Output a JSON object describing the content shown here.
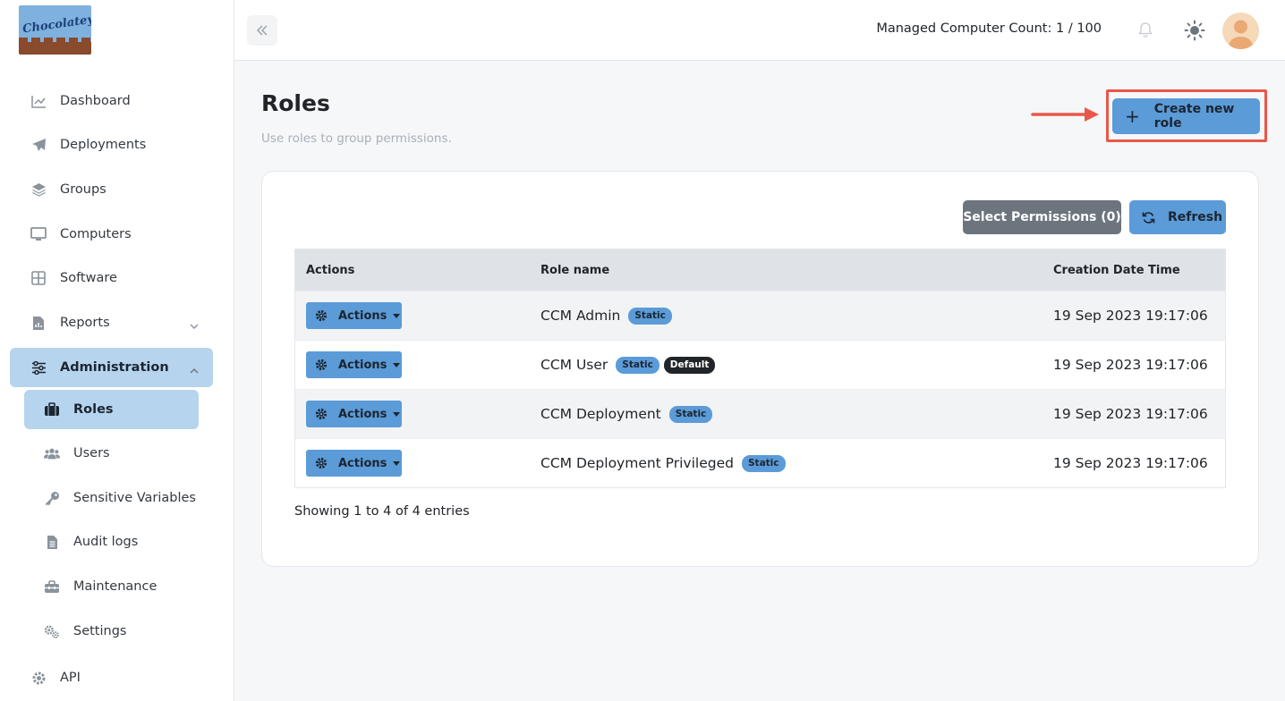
{
  "sidebar": {
    "logo_text": "Chocolatey",
    "items": [
      {
        "label": "Dashboard"
      },
      {
        "label": "Deployments"
      },
      {
        "label": "Groups"
      },
      {
        "label": "Computers"
      },
      {
        "label": "Software"
      },
      {
        "label": "Reports"
      },
      {
        "label": "Administration"
      },
      {
        "label": "API"
      }
    ],
    "admin_sub": [
      {
        "label": "Roles"
      },
      {
        "label": "Users"
      },
      {
        "label": "Sensitive Variables"
      },
      {
        "label": "Audit logs"
      },
      {
        "label": "Maintenance"
      },
      {
        "label": "Settings"
      }
    ]
  },
  "topbar": {
    "computer_count": "Managed Computer Count: 1 / 100"
  },
  "page": {
    "title": "Roles",
    "subtitle": "Use roles to group permissions.",
    "create_button": "Create new role"
  },
  "toolbar": {
    "select_permissions": "Select Permissions (0)",
    "refresh": "Refresh"
  },
  "table": {
    "headers": [
      "Actions",
      "Role name",
      "Creation Date Time"
    ],
    "action_label": "Actions",
    "rows": [
      {
        "name": "CCM Admin",
        "badges": [
          "Static"
        ],
        "created": "19 Sep 2023 19:17:06"
      },
      {
        "name": "CCM User",
        "badges": [
          "Static",
          "Default"
        ],
        "created": "19 Sep 2023 19:17:06"
      },
      {
        "name": "CCM Deployment",
        "badges": [
          "Static"
        ],
        "created": "19 Sep 2023 19:17:06"
      },
      {
        "name": "CCM Deployment Privileged",
        "badges": [
          "Static"
        ],
        "created": "19 Sep 2023 19:17:06"
      }
    ]
  },
  "footer": {
    "showing": "Showing 1 to 4 of 4 entries"
  },
  "colors": {
    "accent": "#5b9bd8",
    "active_nav": "#b6d4ee",
    "highlight": "#e8584a",
    "secondary_button": "#6c757d"
  }
}
